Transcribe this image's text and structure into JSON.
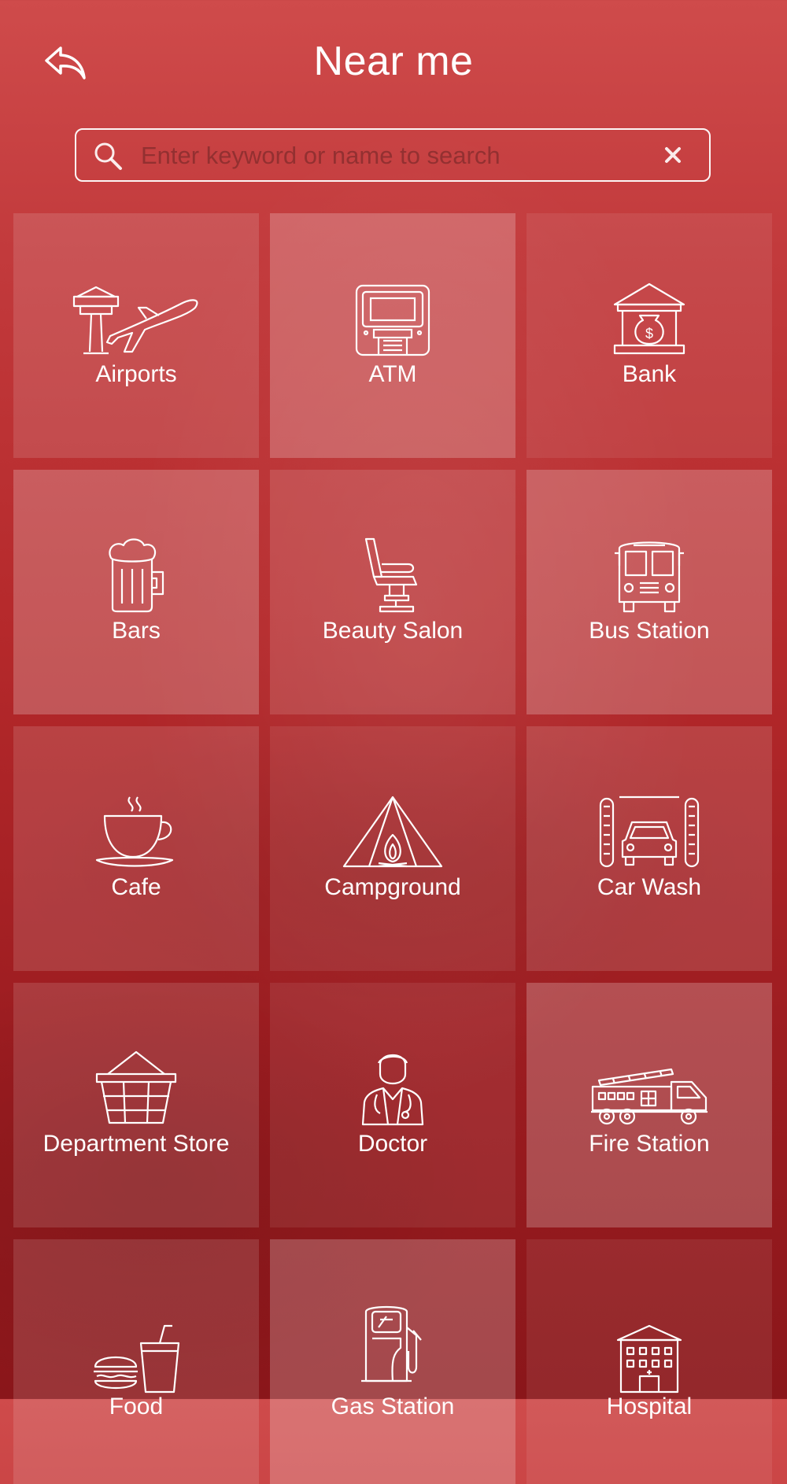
{
  "header": {
    "title": "Near me",
    "back_icon": "back-arrow-icon"
  },
  "search": {
    "placeholder": "Enter keyword or name to search",
    "value": "",
    "search_icon": "search-icon",
    "clear_icon": "close-icon"
  },
  "categories": [
    {
      "label": "Airports",
      "icon": "airport-icon"
    },
    {
      "label": "ATM",
      "icon": "atm-icon"
    },
    {
      "label": "Bank",
      "icon": "bank-icon"
    },
    {
      "label": "Bars",
      "icon": "beer-mug-icon"
    },
    {
      "label": "Beauty Salon",
      "icon": "salon-chair-icon"
    },
    {
      "label": "Bus Station",
      "icon": "bus-icon"
    },
    {
      "label": "Cafe",
      "icon": "coffee-cup-icon"
    },
    {
      "label": "Campground",
      "icon": "tent-icon"
    },
    {
      "label": "Car Wash",
      "icon": "car-wash-icon"
    },
    {
      "label": "Department Store",
      "icon": "basket-icon"
    },
    {
      "label": "Doctor",
      "icon": "doctor-icon"
    },
    {
      "label": "Fire Station",
      "icon": "fire-truck-icon"
    },
    {
      "label": "Food",
      "icon": "burger-drink-icon"
    },
    {
      "label": "Gas Station",
      "icon": "gas-pump-icon"
    },
    {
      "label": "Hospital",
      "icon": "hospital-icon"
    }
  ],
  "colors": {
    "background_top": "#cf4b4b",
    "background_bottom": "#8a161a",
    "foreground": "#ffffff"
  }
}
